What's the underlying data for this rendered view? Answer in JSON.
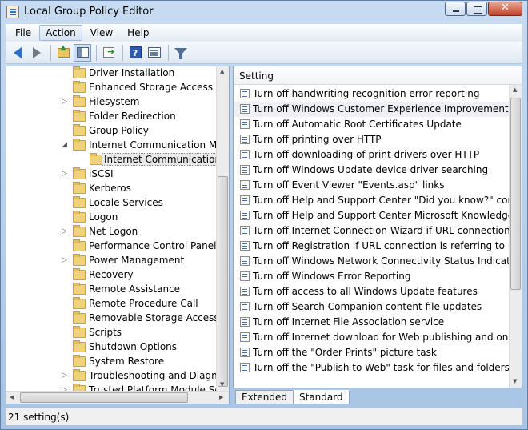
{
  "window": {
    "title": "Local Group Policy Editor",
    "colors": {
      "frame": "#bcd3ec",
      "selection": "#e9e9e9",
      "close_button": "#c0432b"
    }
  },
  "menu": {
    "items": [
      "File",
      "Action",
      "View",
      "Help"
    ],
    "active": "Action"
  },
  "toolbar": {
    "buttons": [
      "back-icon",
      "forward-icon",
      "up-folder-icon",
      "show-hide-tree-icon",
      "export-list-icon",
      "help-icon",
      "properties-icon",
      "filter-icon"
    ]
  },
  "tree": {
    "items": [
      {
        "label": "Driver Installation",
        "expander": ""
      },
      {
        "label": "Enhanced Storage Access",
        "expander": ""
      },
      {
        "label": "Filesystem",
        "expander": "▷"
      },
      {
        "label": "Folder Redirection",
        "expander": ""
      },
      {
        "label": "Group Policy",
        "expander": ""
      },
      {
        "label": "Internet Communication Man",
        "expander": "◢"
      },
      {
        "label": "Internet Communication s",
        "expander": ""
      },
      {
        "label": "iSCSI",
        "expander": "▷"
      },
      {
        "label": "Kerberos",
        "expander": ""
      },
      {
        "label": "Locale Services",
        "expander": ""
      },
      {
        "label": "Logon",
        "expander": ""
      },
      {
        "label": "Net Logon",
        "expander": "▷"
      },
      {
        "label": "Performance Control Panel",
        "expander": ""
      },
      {
        "label": "Power Management",
        "expander": "▷"
      },
      {
        "label": "Recovery",
        "expander": ""
      },
      {
        "label": "Remote Assistance",
        "expander": ""
      },
      {
        "label": "Remote Procedure Call",
        "expander": ""
      },
      {
        "label": "Removable Storage Access",
        "expander": ""
      },
      {
        "label": "Scripts",
        "expander": ""
      },
      {
        "label": "Shutdown Options",
        "expander": ""
      },
      {
        "label": "System Restore",
        "expander": ""
      },
      {
        "label": "Troubleshooting and Diagnost",
        "expander": "▷"
      },
      {
        "label": "Trusted Platform Module Se",
        "expander": "▷"
      }
    ]
  },
  "list": {
    "column_header": "Setting",
    "rows": [
      "Turn off handwriting recognition error reporting",
      "Turn off Windows Customer Experience Improvement Progr...",
      "Turn off Automatic Root Certificates Update",
      "Turn off printing over HTTP",
      "Turn off downloading of print drivers over HTTP",
      "Turn off Windows Update device driver searching",
      "Turn off Event Viewer \"Events.asp\" links",
      "Turn off Help and Support Center \"Did you know?\" content",
      "Turn off Help and Support Center Microsoft Knowledge Bas...",
      "Turn off Internet Connection Wizard if URL connection is ref...",
      "Turn off Registration if URL connection is referring to Micro...",
      "Turn off Windows Network Connectivity Status Indicator act...",
      "Turn off Windows Error Reporting",
      "Turn off access to all Windows Update features",
      "Turn off Search Companion content file updates",
      "Turn off Internet File Association service",
      "Turn off Internet download for Web publishing and online o...",
      "Turn off the \"Order Prints\" picture task",
      "Turn off the \"Publish to Web\" task for files and folders"
    ]
  },
  "tabs": {
    "items": [
      "Extended",
      "Standard"
    ],
    "active": "Standard"
  },
  "status": {
    "text": "21 setting(s)"
  }
}
